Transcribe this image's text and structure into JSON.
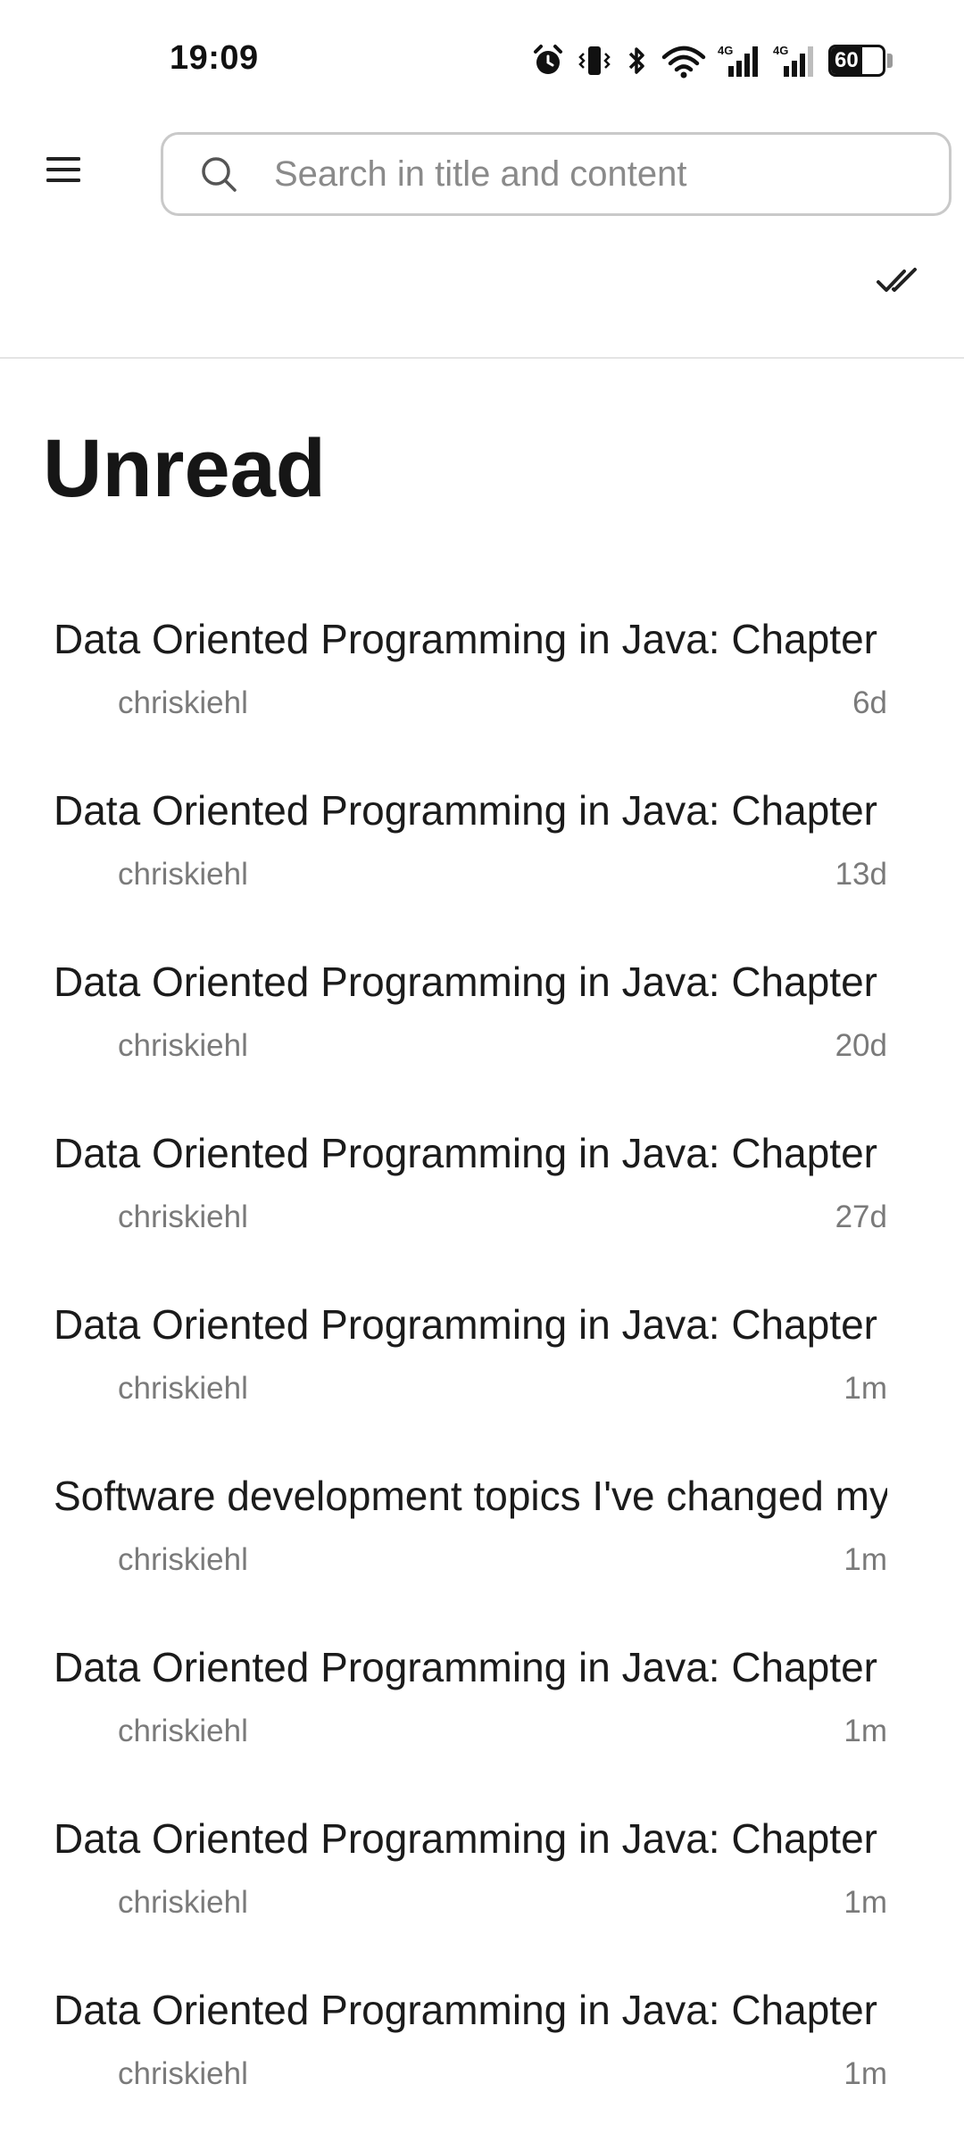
{
  "status_bar": {
    "time": "19:09",
    "battery_level": "60",
    "battery_percent": 60,
    "icons": [
      "alarm-icon",
      "vibrate-icon",
      "bluetooth-icon",
      "wifi-icon",
      "cellular-4g-signal-icon",
      "cellular-4g-signal-icon",
      "battery-icon"
    ],
    "network_labels": [
      "4G",
      "4G"
    ]
  },
  "toolbar": {
    "menu_icon": "hamburger-menu-icon",
    "search_placeholder": "Search in title and content",
    "search_value": "",
    "search_icon": "search-icon",
    "mark_all_read_icon": "double-check-icon"
  },
  "page": {
    "title": "Unread"
  },
  "articles": [
    {
      "title": "Data Oriented Programming in Java: Chapter",
      "author": "chriskiehl",
      "age": "6d"
    },
    {
      "title": "Data Oriented Programming in Java: Chapter",
      "author": "chriskiehl",
      "age": "13d"
    },
    {
      "title": "Data Oriented Programming in Java: Chapter",
      "author": "chriskiehl",
      "age": "20d"
    },
    {
      "title": "Data Oriented Programming in Java: Chapter",
      "author": "chriskiehl",
      "age": "27d"
    },
    {
      "title": "Data Oriented Programming in Java: Chapter",
      "author": "chriskiehl",
      "age": "1m"
    },
    {
      "title": "Software development topics I've changed my mind on",
      "author": "chriskiehl",
      "age": "1m"
    },
    {
      "title": "Data Oriented Programming in Java: Chapter",
      "author": "chriskiehl",
      "age": "1m"
    },
    {
      "title": "Data Oriented Programming in Java: Chapter",
      "author": "chriskiehl",
      "age": "1m"
    },
    {
      "title": "Data Oriented Programming in Java: Chapter",
      "author": "chriskiehl",
      "age": "1m"
    }
  ],
  "colors": {
    "text_primary": "#1b1b1b",
    "text_secondary": "#7a7a7a",
    "border": "#c9c9c9",
    "background": "#ffffff"
  }
}
